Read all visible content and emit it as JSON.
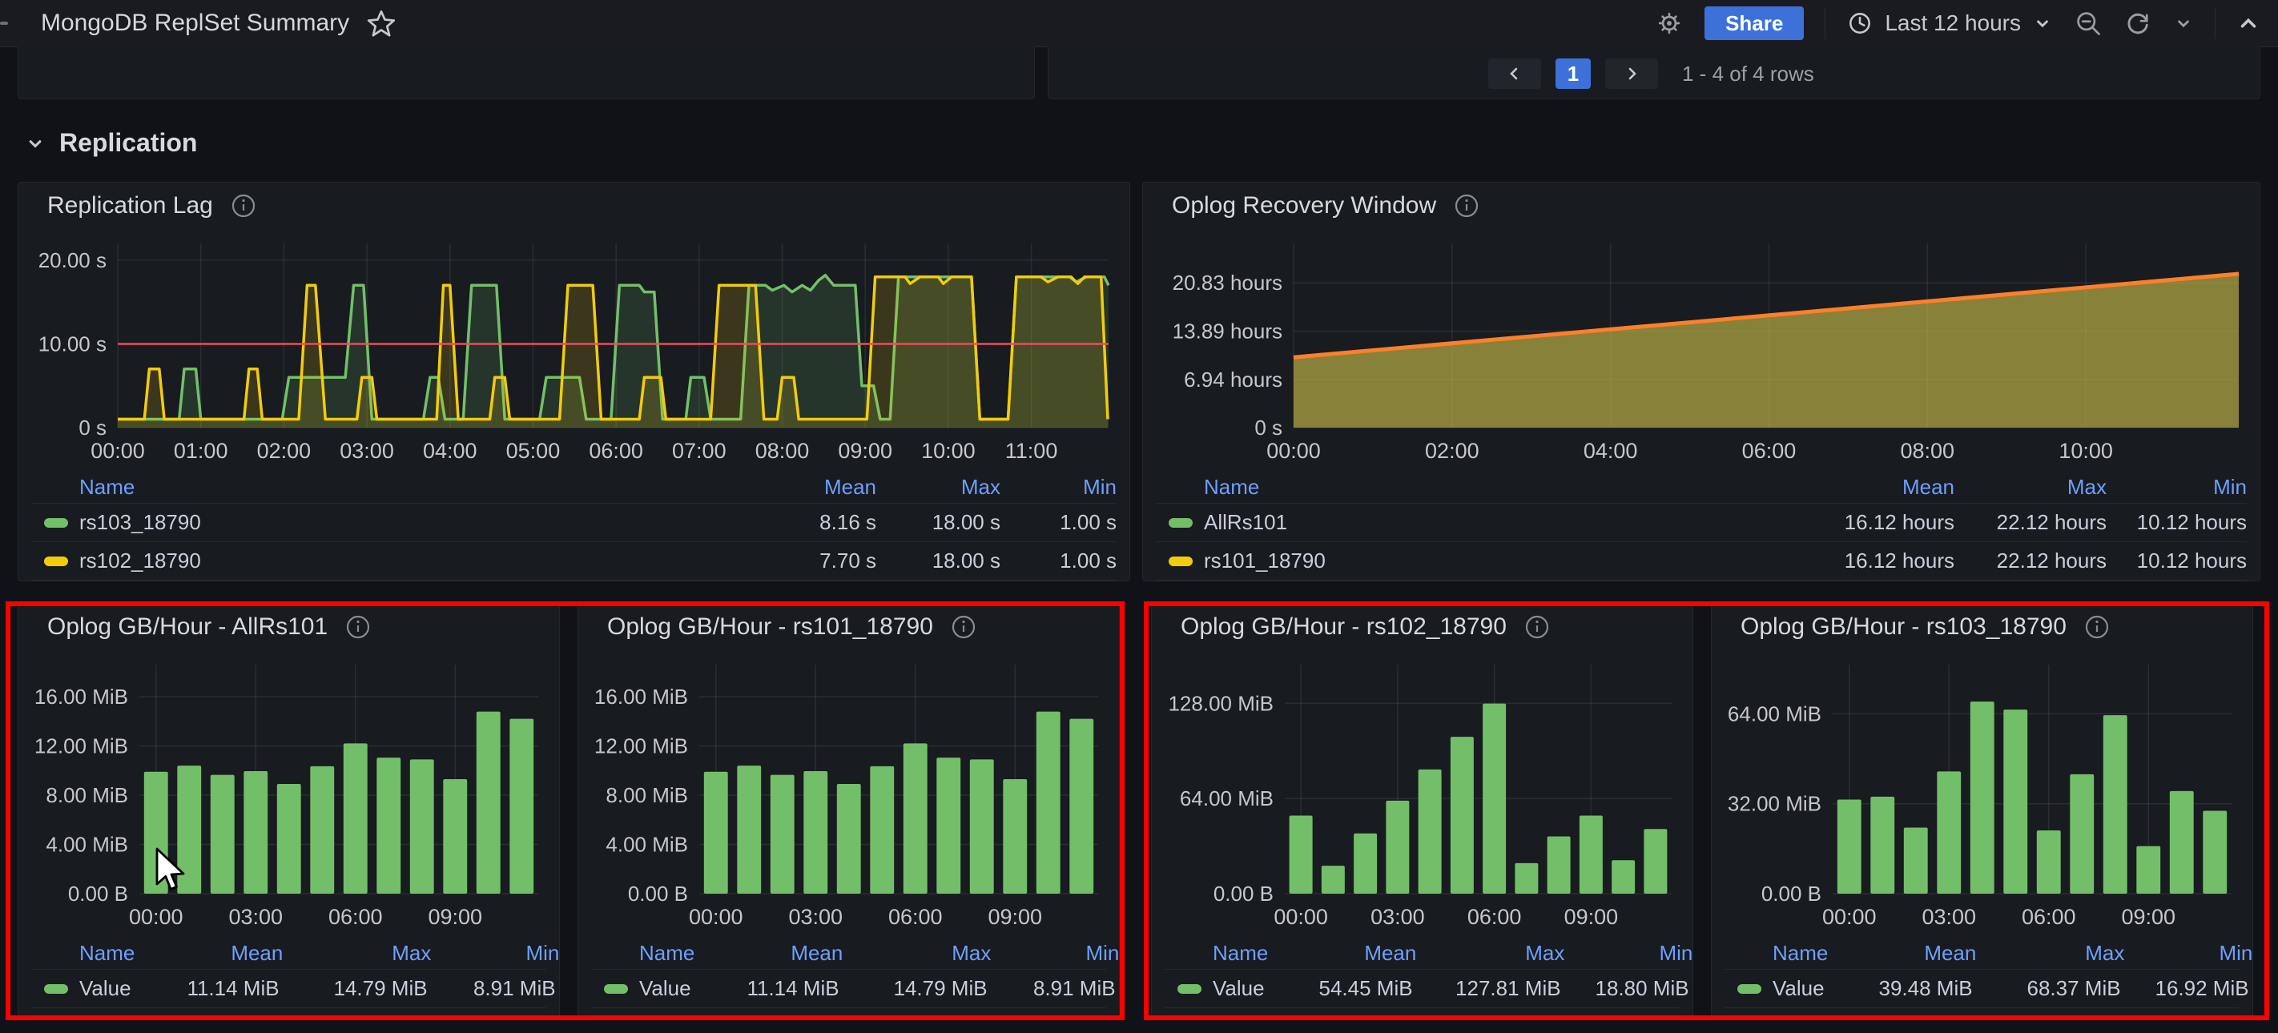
{
  "navbar": {
    "title": "MongoDB ReplSet Summary",
    "share_label": "Share",
    "time_range_label": "Last 12 hours"
  },
  "pagination": {
    "current_page": "1",
    "range_text": "1 - 4 of 4 rows"
  },
  "section": {
    "title": "Replication"
  },
  "legend_headers": {
    "name": "Name",
    "mean": "Mean",
    "max": "Max",
    "min": "Min"
  },
  "colors": {
    "accent_blue": "#3D71D9",
    "link_blue": "#6E9FFF",
    "series_green": "#73BF69",
    "series_yellow": "#F2CC0C",
    "series_orange": "#FF7F2A",
    "threshold_red": "#F2495C",
    "highlight_red": "#FF0000"
  },
  "chart_data": [
    {
      "id": "replication-lag",
      "type": "line",
      "title": "Replication Lag",
      "ylabel": "seconds",
      "y_max": 22,
      "x_min": 0,
      "x_max": 11.93,
      "grid": true,
      "legend_position": "bottom-table",
      "y_ticks": [
        {
          "v": 0,
          "label": "0 s"
        },
        {
          "v": 10,
          "label": "10.00 s"
        },
        {
          "v": 20,
          "label": "20.00 s"
        }
      ],
      "x_ticks": [
        {
          "v": 0,
          "label": "00:00"
        },
        {
          "v": 1,
          "label": "01:00"
        },
        {
          "v": 2,
          "label": "02:00"
        },
        {
          "v": 3,
          "label": "03:00"
        },
        {
          "v": 4,
          "label": "04:00"
        },
        {
          "v": 5,
          "label": "05:00"
        },
        {
          "v": 6,
          "label": "06:00"
        },
        {
          "v": 7,
          "label": "07:00"
        },
        {
          "v": 8,
          "label": "08:00"
        },
        {
          "v": 9,
          "label": "09:00"
        },
        {
          "v": 10,
          "label": "10:00"
        },
        {
          "v": 11,
          "label": "11:00"
        }
      ],
      "threshold": {
        "v": 10,
        "color": "#F2495C"
      },
      "series": [
        {
          "name": "rs103_18790",
          "color": "#73BF69",
          "fill_opacity": 0.16,
          "points": [
            [
              0,
              1
            ],
            [
              0.74,
              1
            ],
            [
              0.8,
              7
            ],
            [
              0.94,
              7
            ],
            [
              1.0,
              1
            ],
            [
              1.98,
              1
            ],
            [
              2.06,
              6
            ],
            [
              2.74,
              6
            ],
            [
              2.84,
              17
            ],
            [
              2.96,
              17
            ],
            [
              3.06,
              1
            ],
            [
              3.68,
              1
            ],
            [
              3.76,
              6
            ],
            [
              3.86,
              6
            ],
            [
              3.94,
              1
            ],
            [
              4.16,
              1
            ],
            [
              4.26,
              17
            ],
            [
              4.56,
              17
            ],
            [
              4.66,
              1
            ],
            [
              5.08,
              1
            ],
            [
              5.16,
              6
            ],
            [
              5.56,
              6
            ],
            [
              5.64,
              1
            ],
            [
              5.94,
              1
            ],
            [
              6.04,
              17
            ],
            [
              6.28,
              17
            ],
            [
              6.34,
              16.2
            ],
            [
              6.46,
              16.2
            ],
            [
              6.56,
              1
            ],
            [
              6.84,
              1
            ],
            [
              6.9,
              6
            ],
            [
              7.06,
              6
            ],
            [
              7.14,
              1
            ],
            [
              7.5,
              1
            ],
            [
              7.6,
              17
            ],
            [
              7.8,
              17
            ],
            [
              7.88,
              16.4
            ],
            [
              8.02,
              17
            ],
            [
              8.12,
              16.2
            ],
            [
              8.24,
              17
            ],
            [
              8.34,
              16.4
            ],
            [
              8.44,
              17.6
            ],
            [
              8.52,
              18.2
            ],
            [
              8.62,
              17
            ],
            [
              8.88,
              17
            ],
            [
              8.96,
              5
            ],
            [
              9.1,
              5
            ],
            [
              9.18,
              1
            ],
            [
              9.3,
              1
            ],
            [
              9.4,
              18
            ],
            [
              10.28,
              18
            ],
            [
              10.38,
              1
            ],
            [
              10.72,
              1
            ],
            [
              10.82,
              18
            ],
            [
              11.46,
              18
            ],
            [
              11.54,
              17.4
            ],
            [
              11.66,
              18
            ],
            [
              11.88,
              18
            ],
            [
              11.93,
              17
            ]
          ]
        },
        {
          "name": "rs102_18790",
          "color": "#F2CC0C",
          "fill_opacity": 0.16,
          "points": [
            [
              0,
              1
            ],
            [
              0.32,
              1
            ],
            [
              0.38,
              7
            ],
            [
              0.5,
              7
            ],
            [
              0.56,
              1
            ],
            [
              1.52,
              1
            ],
            [
              1.58,
              7
            ],
            [
              1.68,
              7
            ],
            [
              1.74,
              1
            ],
            [
              2.18,
              1
            ],
            [
              2.28,
              17
            ],
            [
              2.38,
              17
            ],
            [
              2.5,
              1
            ],
            [
              2.88,
              1
            ],
            [
              2.94,
              6
            ],
            [
              3.06,
              6
            ],
            [
              3.12,
              1
            ],
            [
              3.84,
              1
            ],
            [
              3.92,
              17
            ],
            [
              4.0,
              17
            ],
            [
              4.1,
              1
            ],
            [
              4.48,
              1
            ],
            [
              4.54,
              6
            ],
            [
              4.66,
              6
            ],
            [
              4.72,
              1
            ],
            [
              5.32,
              1
            ],
            [
              5.42,
              17
            ],
            [
              5.72,
              17
            ],
            [
              5.82,
              1
            ],
            [
              6.28,
              1
            ],
            [
              6.34,
              6
            ],
            [
              6.54,
              6
            ],
            [
              6.6,
              1
            ],
            [
              7.14,
              1
            ],
            [
              7.24,
              17
            ],
            [
              7.68,
              17
            ],
            [
              7.78,
              1
            ],
            [
              7.94,
              1
            ],
            [
              8.0,
              6
            ],
            [
              8.14,
              6
            ],
            [
              8.2,
              1
            ],
            [
              9.02,
              1
            ],
            [
              9.12,
              18
            ],
            [
              9.48,
              18
            ],
            [
              9.54,
              17.2
            ],
            [
              9.66,
              18
            ],
            [
              9.88,
              18
            ],
            [
              9.94,
              17.2
            ],
            [
              10.04,
              18
            ],
            [
              10.28,
              18
            ],
            [
              10.38,
              1
            ],
            [
              10.72,
              1
            ],
            [
              10.82,
              18
            ],
            [
              11.12,
              18
            ],
            [
              11.2,
              17.4
            ],
            [
              11.32,
              18
            ],
            [
              11.48,
              18
            ],
            [
              11.56,
              17.2
            ],
            [
              11.64,
              18
            ],
            [
              11.84,
              18
            ],
            [
              11.92,
              1
            ]
          ]
        }
      ],
      "legend": {
        "rows": [
          {
            "name": "rs103_18790",
            "color": "#73BF69",
            "mean": "8.16 s",
            "max": "18.00 s",
            "min": "1.00 s"
          },
          {
            "name": "rs102_18790",
            "color": "#F2CC0C",
            "mean": "7.70 s",
            "max": "18.00 s",
            "min": "1.00 s"
          }
        ]
      }
    },
    {
      "id": "oplog-recovery",
      "type": "area",
      "title": "Oplog Recovery Window",
      "ylabel": "hours",
      "y_max": 26.5,
      "x_min": 0,
      "x_max": 11.93,
      "grid": true,
      "legend_position": "bottom-table",
      "y_ticks": [
        {
          "v": 0,
          "label": "0 s"
        },
        {
          "v": 6.94,
          "label": "6.94 hours"
        },
        {
          "v": 13.89,
          "label": "13.89 hours"
        },
        {
          "v": 20.83,
          "label": "20.83 hours"
        }
      ],
      "x_ticks": [
        {
          "v": 0,
          "label": "00:00"
        },
        {
          "v": 2,
          "label": "02:00"
        },
        {
          "v": 4,
          "label": "04:00"
        },
        {
          "v": 6,
          "label": "06:00"
        },
        {
          "v": 8,
          "label": "08:00"
        },
        {
          "v": 10,
          "label": "10:00"
        }
      ],
      "series": [
        {
          "name": "rs101_18790",
          "color": "#F2CC0C",
          "fill_color": "rgba(115,191,105,0.35)",
          "points": [
            [
              0,
              10.12
            ],
            [
              11.93,
              22.12
            ]
          ]
        },
        {
          "name": "AllRs101",
          "color": "#73BF69",
          "line_color": "#FF7F2A",
          "line_width": 5,
          "fill_color": "rgba(234,184,57,0.45)",
          "points": [
            [
              0,
              10.12
            ],
            [
              11.93,
              22.12
            ]
          ]
        }
      ],
      "legend": {
        "rows": [
          {
            "name": "AllRs101",
            "color": "#73BF69",
            "mean": "16.12 hours",
            "max": "22.12 hours",
            "min": "10.12 hours"
          },
          {
            "name": "rs101_18790",
            "color": "#F2CC0C",
            "mean": "16.12 hours",
            "max": "22.12 hours",
            "min": "10.12 hours"
          }
        ]
      }
    },
    {
      "id": "oplog-allrs101",
      "type": "bar",
      "title": "Oplog GB/Hour - AllRs101",
      "bar_color": "#73BF69",
      "y_max": 18.6,
      "grid": true,
      "legend_position": "bottom-table",
      "y_ticks": [
        {
          "v": 0,
          "label": "0.00 B"
        },
        {
          "v": 4,
          "label": "4.00 MiB"
        },
        {
          "v": 8,
          "label": "8.00 MiB"
        },
        {
          "v": 12,
          "label": "12.00 MiB"
        },
        {
          "v": 16,
          "label": "16.00 MiB"
        }
      ],
      "x_ticks": [
        {
          "i": 0,
          "label": "00:00"
        },
        {
          "i": 3,
          "label": "03:00"
        },
        {
          "i": 6,
          "label": "06:00"
        },
        {
          "i": 9,
          "label": "09:00"
        }
      ],
      "categories": [
        "00:00",
        "01:00",
        "02:00",
        "03:00",
        "04:00",
        "05:00",
        "06:00",
        "07:00",
        "08:00",
        "09:00",
        "10:00",
        "11:00"
      ],
      "values": [
        9.9,
        10.4,
        9.65,
        9.95,
        8.91,
        10.35,
        12.2,
        11.05,
        10.9,
        9.3,
        14.79,
        14.2
      ],
      "legend": {
        "rows": [
          {
            "name": "Value",
            "color": "#73BF69",
            "mean": "11.14 MiB",
            "max": "14.79 MiB",
            "min": "8.91 MiB"
          }
        ]
      }
    },
    {
      "id": "oplog-rs101",
      "type": "bar",
      "title": "Oplog GB/Hour - rs101_18790",
      "bar_color": "#73BF69",
      "y_max": 18.6,
      "grid": true,
      "legend_position": "bottom-table",
      "y_ticks": [
        {
          "v": 0,
          "label": "0.00 B"
        },
        {
          "v": 4,
          "label": "4.00 MiB"
        },
        {
          "v": 8,
          "label": "8.00 MiB"
        },
        {
          "v": 12,
          "label": "12.00 MiB"
        },
        {
          "v": 16,
          "label": "16.00 MiB"
        }
      ],
      "x_ticks": [
        {
          "i": 0,
          "label": "00:00"
        },
        {
          "i": 3,
          "label": "03:00"
        },
        {
          "i": 6,
          "label": "06:00"
        },
        {
          "i": 9,
          "label": "09:00"
        }
      ],
      "categories": [
        "00:00",
        "01:00",
        "02:00",
        "03:00",
        "04:00",
        "05:00",
        "06:00",
        "07:00",
        "08:00",
        "09:00",
        "10:00",
        "11:00"
      ],
      "values": [
        9.9,
        10.4,
        9.65,
        9.95,
        8.91,
        10.35,
        12.2,
        11.05,
        10.9,
        9.3,
        14.79,
        14.2
      ],
      "legend": {
        "rows": [
          {
            "name": "Value",
            "color": "#73BF69",
            "mean": "11.14 MiB",
            "max": "14.79 MiB",
            "min": "8.91 MiB"
          }
        ]
      }
    },
    {
      "id": "oplog-rs102",
      "type": "bar",
      "title": "Oplog GB/Hour - rs102_18790",
      "bar_color": "#73BF69",
      "y_max": 154,
      "grid": true,
      "legend_position": "bottom-table",
      "y_ticks": [
        {
          "v": 0,
          "label": "0.00 B"
        },
        {
          "v": 64,
          "label": "64.00 MiB"
        },
        {
          "v": 128,
          "label": "128.00 MiB"
        }
      ],
      "x_ticks": [
        {
          "i": 0,
          "label": "00:00"
        },
        {
          "i": 3,
          "label": "03:00"
        },
        {
          "i": 6,
          "label": "06:00"
        },
        {
          "i": 9,
          "label": "09:00"
        }
      ],
      "categories": [
        "00:00",
        "01:00",
        "02:00",
        "03:00",
        "04:00",
        "05:00",
        "06:00",
        "07:00",
        "08:00",
        "09:00",
        "10:00",
        "11:00"
      ],
      "values": [
        52.5,
        18.8,
        40.5,
        62.5,
        83.5,
        105.5,
        127.81,
        20.5,
        38.5,
        52.5,
        22.5,
        43.5
      ],
      "legend": {
        "rows": [
          {
            "name": "Value",
            "color": "#73BF69",
            "mean": "54.45 MiB",
            "max": "127.81 MiB",
            "min": "18.80 MiB"
          }
        ]
      }
    },
    {
      "id": "oplog-rs103",
      "type": "bar",
      "title": "Oplog GB/Hour - rs103_18790",
      "bar_color": "#73BF69",
      "y_max": 81.5,
      "grid": true,
      "legend_position": "bottom-table",
      "y_ticks": [
        {
          "v": 0,
          "label": "0.00 B"
        },
        {
          "v": 32,
          "label": "32.00 MiB"
        },
        {
          "v": 64,
          "label": "64.00 MiB"
        }
      ],
      "x_ticks": [
        {
          "i": 0,
          "label": "00:00"
        },
        {
          "i": 3,
          "label": "03:00"
        },
        {
          "i": 6,
          "label": "06:00"
        },
        {
          "i": 9,
          "label": "09:00"
        }
      ],
      "categories": [
        "00:00",
        "01:00",
        "02:00",
        "03:00",
        "04:00",
        "05:00",
        "06:00",
        "07:00",
        "08:00",
        "09:00",
        "10:00",
        "11:00"
      ],
      "values": [
        33.5,
        34.5,
        23.5,
        43.5,
        68.37,
        65.5,
        22.5,
        42.5,
        63.5,
        16.92,
        36.5,
        29.5
      ],
      "legend": {
        "rows": [
          {
            "name": "Value",
            "color": "#73BF69",
            "mean": "39.48 MiB",
            "max": "68.37 MiB",
            "min": "16.92 MiB"
          }
        ]
      }
    }
  ]
}
